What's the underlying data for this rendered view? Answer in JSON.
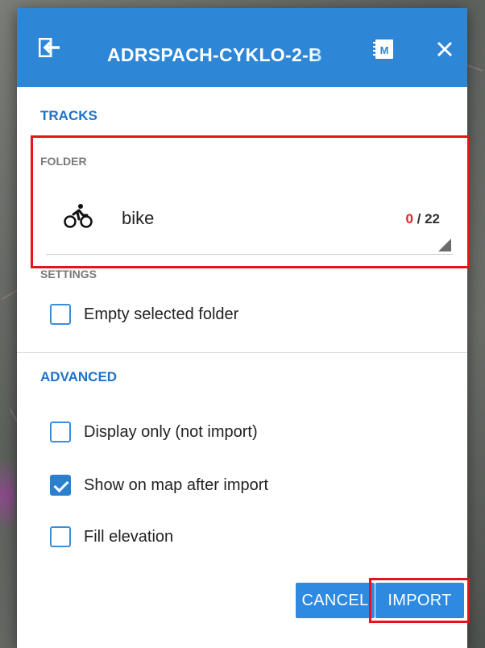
{
  "dialog": {
    "title": "ADRSPACH-CYKLO-2-B",
    "icons": {
      "left": "import-exit-icon",
      "menu": "map-menu-icon",
      "close": "close-icon"
    },
    "tracks_header": "TRACKS",
    "folder": {
      "label": "FOLDER",
      "icon": "bike-icon",
      "name": "bike",
      "selected_count": "0",
      "count_separator": " / ",
      "total_count": "22"
    },
    "settings": {
      "label": "SETTINGS",
      "options": [
        {
          "label": "Empty selected folder",
          "checked": false
        }
      ]
    },
    "advanced": {
      "header": "ADVANCED",
      "options": [
        {
          "label": "Display only (not import)",
          "checked": false
        },
        {
          "label": "Show on map after import",
          "checked": true
        },
        {
          "label": "Fill elevation",
          "checked": false
        }
      ]
    },
    "buttons": {
      "cancel": "CANCEL",
      "import": "IMPORT"
    }
  },
  "colors": {
    "titlebar": "#2d87d6",
    "accent": "#1e73c8",
    "highlight": "#e3141b",
    "button": "#2e8ae0"
  }
}
